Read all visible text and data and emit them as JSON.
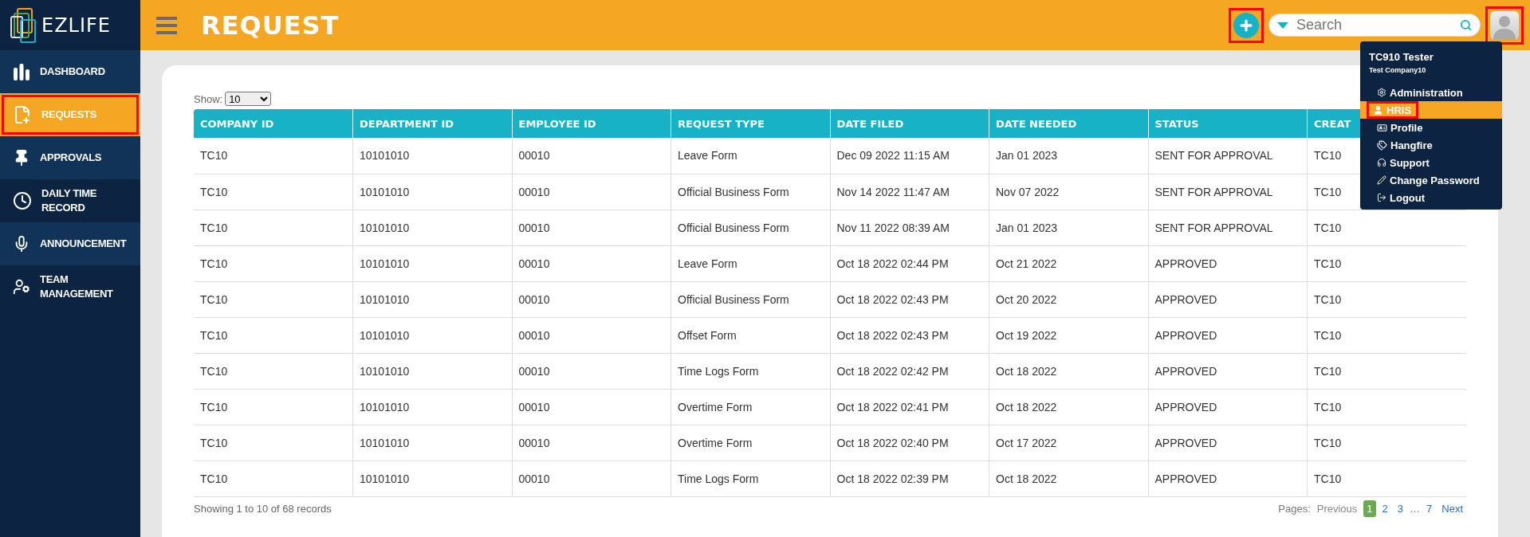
{
  "brand": "EZLIFE",
  "sidebar": {
    "items": [
      {
        "label": "DASHBOARD",
        "kind": "dashboard",
        "selected": false,
        "highlighted": false
      },
      {
        "label": "REQUESTS",
        "kind": "requests",
        "selected": true,
        "highlighted": true
      },
      {
        "label": "APPROVALS",
        "kind": "approvals",
        "selected": false,
        "highlighted": false
      },
      {
        "label": "DAILY TIME RECORD",
        "kind": "time",
        "selected": false,
        "highlighted": false
      },
      {
        "label": "ANNOUNCEMENT",
        "kind": "announcement",
        "selected": false,
        "highlighted": false
      },
      {
        "label": "TEAM MANAGEMENT",
        "kind": "team",
        "selected": false,
        "highlighted": false
      }
    ]
  },
  "header": {
    "title": "REQUEST",
    "add_button": {
      "highlighted": true
    },
    "search": {
      "placeholder": "Search"
    },
    "avatar": {
      "highlighted": true
    }
  },
  "user_menu": {
    "name": "TC910 Tester",
    "company": "Test Company10",
    "items": [
      {
        "label": "Administration",
        "kind": "admin",
        "selected": false,
        "highlighted": false
      },
      {
        "label": "HRIS",
        "kind": "hris",
        "selected": true,
        "highlighted": true
      },
      {
        "label": "Profile",
        "kind": "profile",
        "selected": false,
        "highlighted": false
      },
      {
        "label": "Hangfire",
        "kind": "hangfire",
        "selected": false,
        "highlighted": false
      },
      {
        "label": "Support",
        "kind": "support",
        "selected": false,
        "highlighted": false
      },
      {
        "label": "Change Password",
        "kind": "password",
        "selected": false,
        "highlighted": false
      },
      {
        "label": "Logout",
        "kind": "logout",
        "selected": false,
        "highlighted": false
      }
    ]
  },
  "table": {
    "show_label": "Show:",
    "page_size": "10",
    "columns": [
      "COMPANY ID",
      "DEPARTMENT ID",
      "EMPLOYEE ID",
      "REQUEST TYPE",
      "DATE FILED",
      "DATE NEEDED",
      "STATUS",
      "CREAT"
    ],
    "rows": [
      [
        "TC10",
        "10101010",
        "00010",
        "Leave Form",
        "Dec 09 2022 11:15 AM",
        "Jan 01 2023",
        "SENT FOR APPROVAL",
        "TC10"
      ],
      [
        "TC10",
        "10101010",
        "00010",
        "Official Business Form",
        "Nov 14 2022 11:47 AM",
        "Nov 07 2022",
        "SENT FOR APPROVAL",
        "TC10"
      ],
      [
        "TC10",
        "10101010",
        "00010",
        "Official Business Form",
        "Nov 11 2022 08:39 AM",
        "Jan 01 2023",
        "SENT FOR APPROVAL",
        "TC10"
      ],
      [
        "TC10",
        "10101010",
        "00010",
        "Leave Form",
        "Oct 18 2022 02:44 PM",
        "Oct 21 2022",
        "APPROVED",
        "TC10"
      ],
      [
        "TC10",
        "10101010",
        "00010",
        "Official Business Form",
        "Oct 18 2022 02:43 PM",
        "Oct 20 2022",
        "APPROVED",
        "TC10"
      ],
      [
        "TC10",
        "10101010",
        "00010",
        "Offset Form",
        "Oct 18 2022 02:43 PM",
        "Oct 19 2022",
        "APPROVED",
        "TC10"
      ],
      [
        "TC10",
        "10101010",
        "00010",
        "Time Logs Form",
        "Oct 18 2022 02:42 PM",
        "Oct 18 2022",
        "APPROVED",
        "TC10"
      ],
      [
        "TC10",
        "10101010",
        "00010",
        "Overtime Form",
        "Oct 18 2022 02:41 PM",
        "Oct 18 2022",
        "APPROVED",
        "TC10"
      ],
      [
        "TC10",
        "10101010",
        "00010",
        "Overtime Form",
        "Oct 18 2022 02:40 PM",
        "Oct 17 2022",
        "APPROVED",
        "TC10"
      ],
      [
        "TC10",
        "10101010",
        "00010",
        "Time Logs Form",
        "Oct 18 2022 02:39 PM",
        "Oct 18 2022",
        "APPROVED",
        "TC10"
      ]
    ],
    "summary": "Showing 1 to 10 of 68 records"
  },
  "pagination": {
    "label": "Pages:",
    "items": [
      {
        "label": "Previous",
        "kind": "nav",
        "disabled": true,
        "selected": false
      },
      {
        "label": "1",
        "kind": "page",
        "disabled": false,
        "selected": true
      },
      {
        "label": "2",
        "kind": "page",
        "disabled": false,
        "selected": false
      },
      {
        "label": "3",
        "kind": "page",
        "disabled": false,
        "selected": false
      },
      {
        "label": "…",
        "kind": "gap"
      },
      {
        "label": "7",
        "kind": "page",
        "disabled": false,
        "selected": false
      },
      {
        "label": "Next",
        "kind": "nav",
        "disabled": false,
        "selected": false
      }
    ]
  }
}
